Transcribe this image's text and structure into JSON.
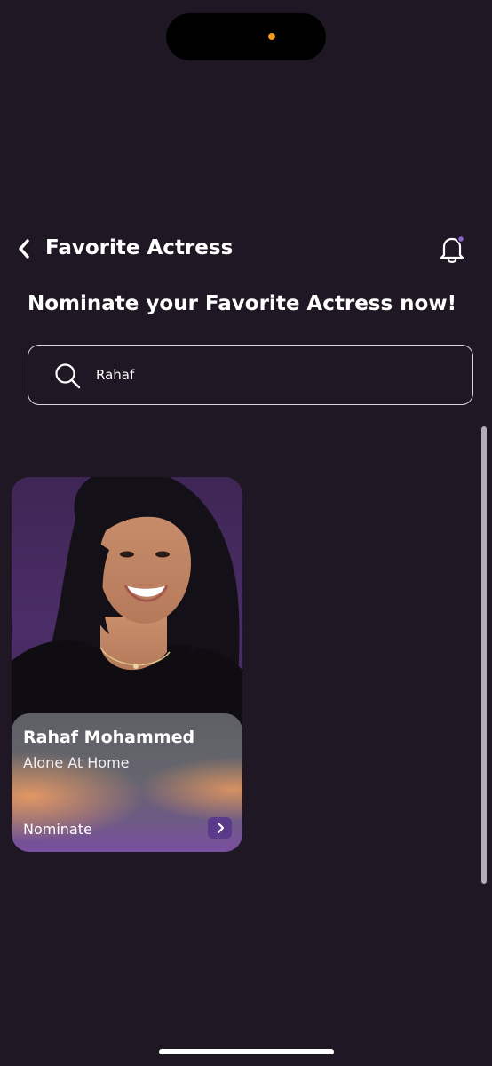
{
  "status_bar": {
    "indicator_color": "#f39a1c"
  },
  "header": {
    "title": "Favorite Actress",
    "back_icon": "chevron-left-icon",
    "notification_icon": "bell-icon",
    "notification_dot_color": "#8a63c9"
  },
  "page": {
    "subtitle": "Nominate your Favorite Actress now!"
  },
  "search": {
    "icon": "search-icon",
    "value": "Rahaf"
  },
  "results": [
    {
      "name": "Rahaf Mohammed",
      "work": "Alone At Home",
      "action_label": "Nominate",
      "action_icon": "chevron-right-icon"
    }
  ],
  "colors": {
    "background": "#1f1824",
    "accent": "#5a3a8a"
  }
}
